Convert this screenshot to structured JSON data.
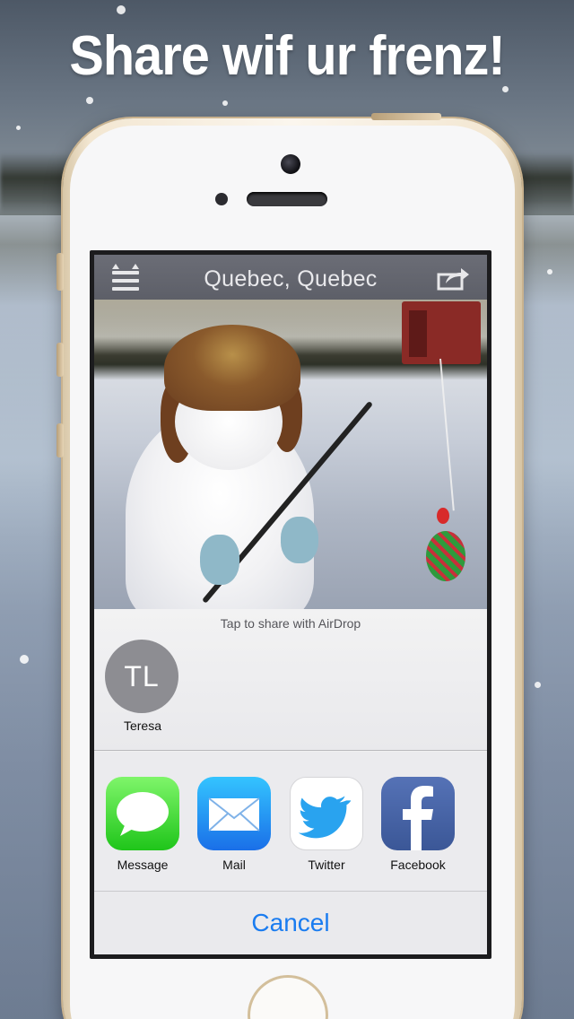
{
  "promo": {
    "headline": "Share wif ur frenz!"
  },
  "app": {
    "title": "Quebec, Quebec",
    "menu_icon": "cat-menu-icon",
    "share_icon": "share-icon"
  },
  "share_sheet": {
    "airdrop_hint": "Tap to share with AirDrop",
    "contacts": [
      {
        "initials": "TL",
        "name": "Teresa"
      }
    ],
    "apps": [
      {
        "label": "Message",
        "icon": "message-icon"
      },
      {
        "label": "Mail",
        "icon": "mail-icon"
      },
      {
        "label": "Twitter",
        "icon": "twitter-icon"
      },
      {
        "label": "Facebook",
        "icon": "facebook-icon"
      }
    ],
    "cancel_label": "Cancel"
  },
  "colors": {
    "accent": "#1a7cf0",
    "navbar": "#646670",
    "avatar": "#8d8d92"
  }
}
